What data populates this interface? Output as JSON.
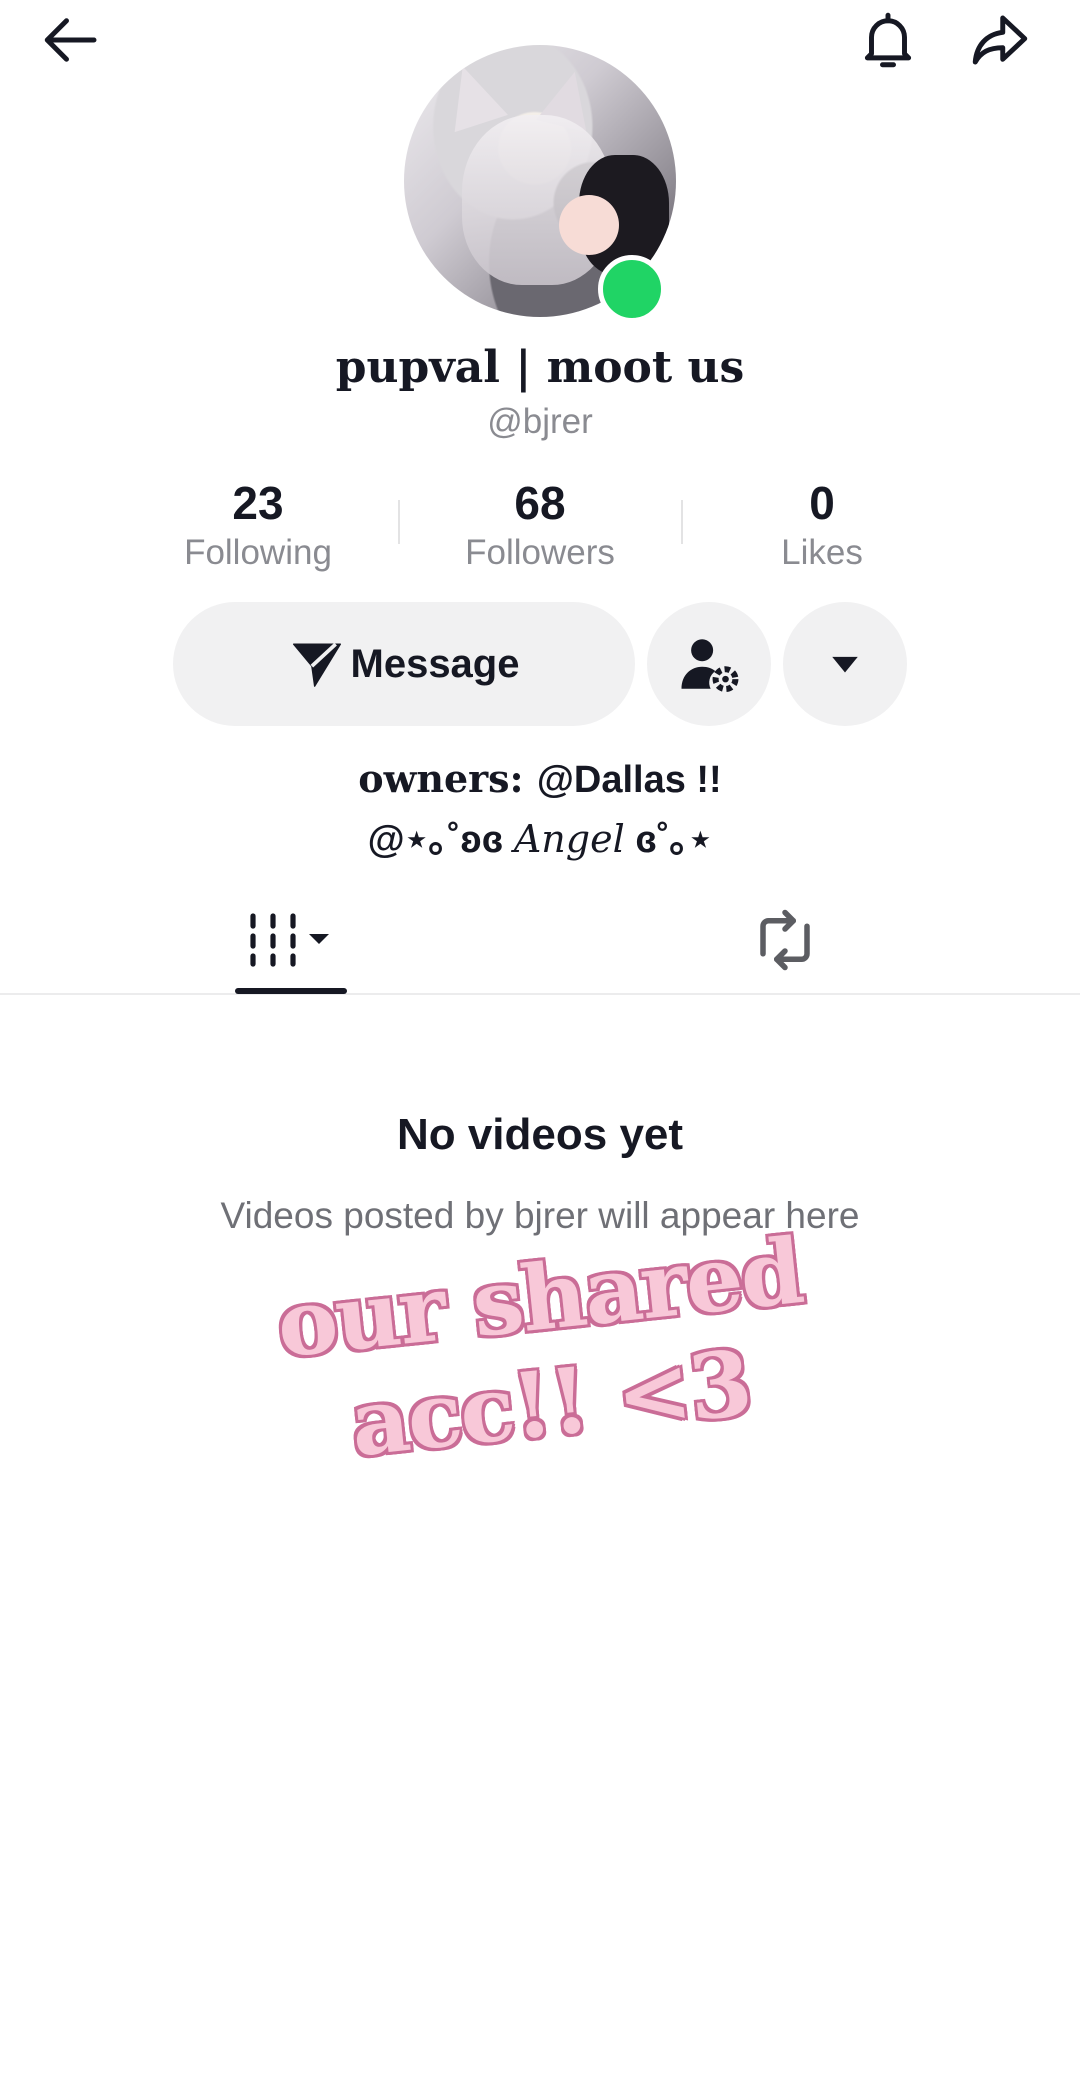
{
  "header": {
    "back_icon": "arrow-left-icon",
    "bell_icon": "bell-icon",
    "share_icon": "share-arrow-icon"
  },
  "profile": {
    "display_name": "pupval | moot us",
    "handle": "@bjrer",
    "online_status_color": "#20d465"
  },
  "stats": [
    {
      "value": "23",
      "label": "Following"
    },
    {
      "value": "68",
      "label": "Followers"
    },
    {
      "value": "0",
      "label": "Likes"
    }
  ],
  "actions": {
    "message_label": "Message",
    "message_icon": "send-icon",
    "friend_settings_icon": "user-gear-icon",
    "more_icon": "caret-down-icon"
  },
  "bio": {
    "line1_prefix": "owners: ",
    "line1_mention": "@Dallas !!",
    "line2_prefix": "@⋆｡˚",
    "line2_deco": "ʚɞ",
    "line2_name": "Angel",
    "line2_suffix": "ɞ˚｡⋆"
  },
  "tabs": {
    "videos_icon": "grid-columns-icon",
    "reposts_icon": "repost-icon"
  },
  "empty_state": {
    "title": "No videos yet",
    "subtitle": "Videos posted by bjrer will appear here"
  },
  "overlay": {
    "sticker_text": "our shared acc!! <3",
    "sticker_fill": "#f8c8d8",
    "sticker_outline": "#ca6d97"
  }
}
